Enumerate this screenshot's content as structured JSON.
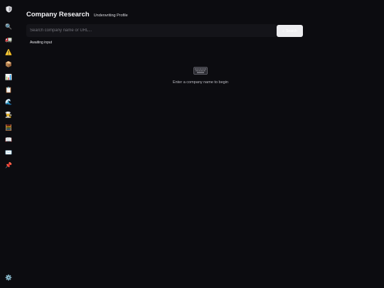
{
  "sidebar": {
    "logo_icon": "shield-icon",
    "items": [
      {
        "icon": "search-icon",
        "glyph": "🔍"
      },
      {
        "icon": "truck-icon",
        "glyph": "🚛"
      },
      {
        "icon": "warning-icon",
        "glyph": "⚠️"
      },
      {
        "icon": "package-icon",
        "glyph": "📦"
      },
      {
        "icon": "chart-icon",
        "glyph": "📊"
      },
      {
        "icon": "clipboard-icon",
        "glyph": "📋"
      },
      {
        "icon": "wave-icon",
        "glyph": "🌊"
      },
      {
        "icon": "chef-icon",
        "glyph": "👨‍🍳"
      },
      {
        "icon": "abacus-icon",
        "glyph": "🧮"
      },
      {
        "icon": "book-icon",
        "glyph": "📖"
      },
      {
        "icon": "envelope-icon",
        "glyph": "✉️"
      },
      {
        "icon": "pushpin-icon",
        "glyph": "📌"
      }
    ],
    "settings_glyph": "⚙️"
  },
  "header": {
    "title": "Company Research",
    "subtitle": "Underwriting Profile"
  },
  "search": {
    "placeholder": "Search company name or URL...",
    "value": "",
    "button_label": "Search"
  },
  "status": "Awaiting input",
  "empty_state": {
    "icon": "keyboard-icon",
    "message": "Enter a company name to begin"
  }
}
